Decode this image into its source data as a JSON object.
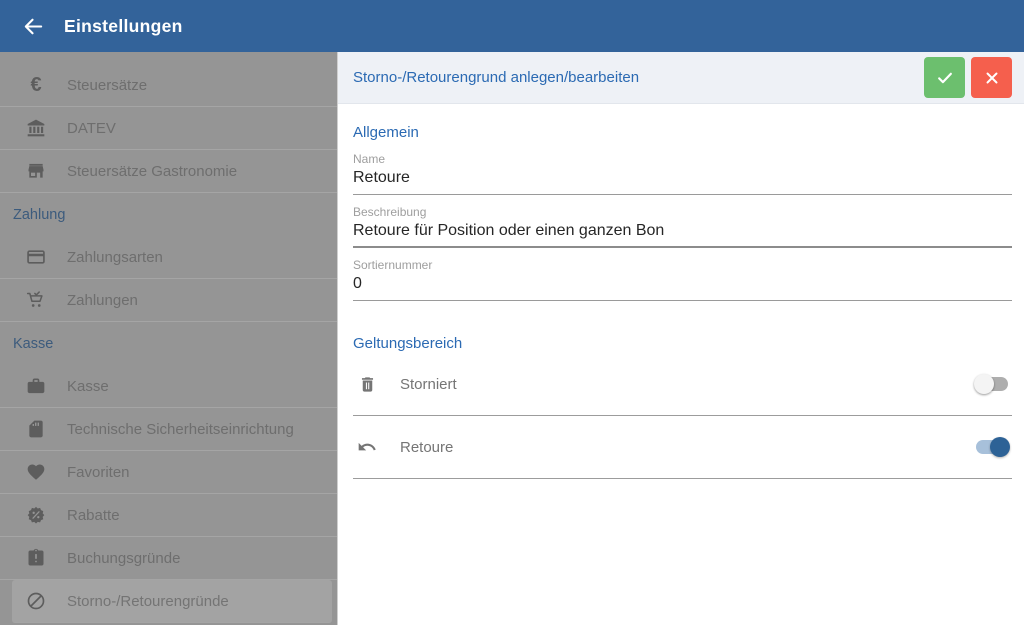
{
  "colors": {
    "topbar_blue": "#33639a",
    "accent_blue": "#2b6ab3",
    "confirm_green": "#6cbf6e",
    "cancel_red": "#f55f4d",
    "toggle_on_blue": "#2d6296",
    "sidebar_dimmed_gray": "#959595"
  },
  "topbar": {
    "back_icon": "arrow-back-icon",
    "title": "Einstellungen"
  },
  "sidebar": {
    "groups": [
      {
        "items": [
          {
            "icon": "euro-icon",
            "label": "Steuersätze"
          },
          {
            "icon": "bank-icon",
            "label": "DATEV"
          },
          {
            "icon": "store-icon",
            "label": "Steuersätze Gastronomie"
          }
        ]
      },
      {
        "header": "Zahlung",
        "items": [
          {
            "icon": "credit-card-icon",
            "label": "Zahlungsarten"
          },
          {
            "icon": "cart-check-icon",
            "label": "Zahlungen"
          }
        ]
      },
      {
        "header": "Kasse",
        "items": [
          {
            "icon": "briefcase-icon",
            "label": "Kasse"
          },
          {
            "icon": "sd-card-icon",
            "label": "Technische Sicherheitseinrichtung"
          },
          {
            "icon": "heart-icon",
            "label": "Favoriten"
          },
          {
            "icon": "discount-icon",
            "label": "Rabatte"
          },
          {
            "icon": "clipboard-alert-icon",
            "label": "Buchungsgründe"
          },
          {
            "icon": "block-icon",
            "label": "Storno-/Retourengründe",
            "selected": true
          }
        ]
      }
    ]
  },
  "dialog": {
    "title": "Storno-/Retourengrund anlegen/bearbeiten",
    "confirm_icon": "check",
    "cancel_icon": "close",
    "sections": {
      "allgemein": {
        "title": "Allgemein",
        "fields": [
          {
            "label": "Name",
            "value": "Retoure"
          },
          {
            "label": "Beschreibung",
            "value": "Retoure für Position oder einen ganzen Bon"
          },
          {
            "label": "Sortiernummer",
            "value": "0"
          }
        ]
      },
      "geltungsbereich": {
        "title": "Geltungsbereich",
        "toggles": [
          {
            "icon": "trash-icon",
            "label": "Storniert",
            "on": false
          },
          {
            "icon": "undo-icon",
            "label": "Retoure",
            "on": true
          }
        ]
      }
    }
  }
}
